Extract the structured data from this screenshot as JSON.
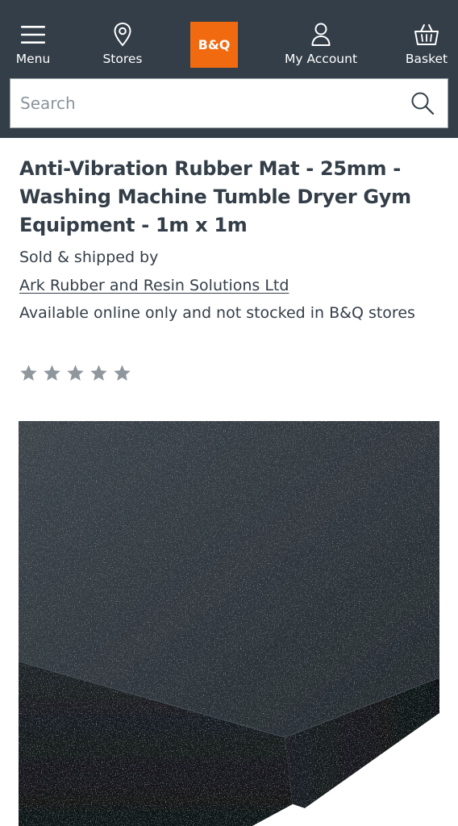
{
  "header": {
    "nav": {
      "menu": {
        "label": "Menu",
        "icon": "hamburger-menu-icon"
      },
      "stores": {
        "label": "Stores",
        "icon": "location-pin-icon"
      },
      "account": {
        "label": "My Account",
        "icon": "user-icon"
      },
      "basket": {
        "label": "Basket",
        "icon": "basket-icon"
      }
    },
    "logo": {
      "text": "B&Q",
      "color": "#f26a10"
    },
    "background": "#333e48"
  },
  "search": {
    "placeholder": "Search",
    "value": "",
    "icon": "search-icon"
  },
  "product": {
    "title": "Anti-Vibration Rubber Mat - 25mm - Washing Machine Tumble Dryer Gym Equipment - 1m x 1m",
    "sold_by_label": "Sold & shipped by",
    "seller": "Ark Rubber and Resin Solutions Ltd",
    "availability": "Available online only and not stocked in B&Q stores",
    "rating": {
      "value": 0,
      "max": 5,
      "star_color": "#8f969c"
    }
  }
}
